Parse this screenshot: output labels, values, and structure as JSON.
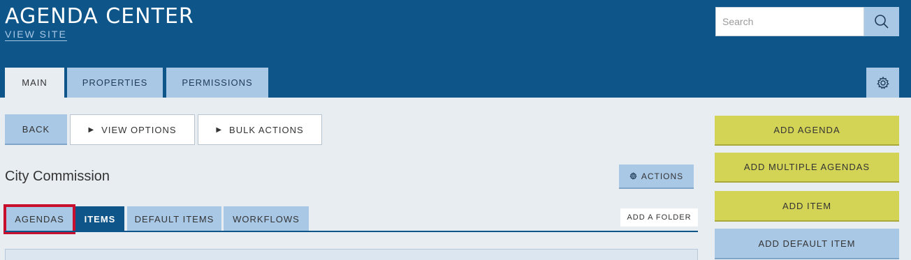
{
  "header": {
    "title": "AGENDA CENTER",
    "view_site": "VIEW SITE",
    "search_placeholder": "Search"
  },
  "top_tabs": [
    {
      "label": "MAIN",
      "active": true
    },
    {
      "label": "PROPERTIES",
      "active": false
    },
    {
      "label": "PERMISSIONS",
      "active": false
    }
  ],
  "toolbar": {
    "back": "BACK",
    "view_options": "VIEW OPTIONS",
    "bulk_actions": "BULK ACTIONS"
  },
  "section": {
    "title": "City Commission",
    "actions": "ACTIONS"
  },
  "sub_tabs": [
    {
      "label": "AGENDAS",
      "active": false,
      "highlighted": true
    },
    {
      "label": "ITEMS",
      "active": true
    },
    {
      "label": "DEFAULT ITEMS",
      "active": false
    },
    {
      "label": "WORKFLOWS",
      "active": false
    }
  ],
  "add_folder": "ADD A FOLDER",
  "side_buttons": {
    "add_agenda": "ADD AGENDA",
    "add_multiple_agendas": "ADD MULTIPLE AGENDAS",
    "add_item": "ADD ITEM",
    "add_default_item": "ADD DEFAULT ITEM"
  },
  "icons": {
    "triangle": "▶"
  },
  "colors": {
    "header": "#0e5589",
    "tab": "#a9c8e6",
    "green_button": "#d3d456",
    "highlight": "#c8102e"
  }
}
